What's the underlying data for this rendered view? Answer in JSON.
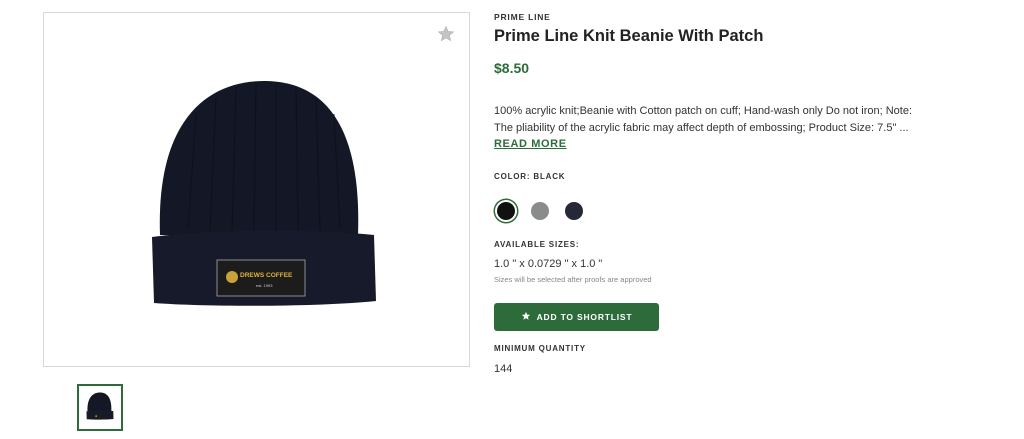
{
  "product": {
    "brand": "PRIME LINE",
    "title": "Prime Line Knit Beanie With Patch",
    "price": "$8.50",
    "description_line1": "100% acrylic knit;Beanie with Cotton patch on cuff; Hand-wash only Do not iron; Note:",
    "description_line2": "The pliability of the acrylic fabric may affect depth of embossing; Product Size: 7.5\" ...",
    "read_more": "READ MORE",
    "patch_text": "DREWS COFFEE",
    "patch_subtext": "est. 1993"
  },
  "color": {
    "label": "COLOR: BLACK",
    "swatches": [
      {
        "name": "Black",
        "hex": "#111111",
        "selected": true
      },
      {
        "name": "Gray",
        "hex": "#8a8c8b",
        "selected": false
      },
      {
        "name": "Navy",
        "hex": "#262838",
        "selected": false
      }
    ]
  },
  "sizes": {
    "label": "AVAILABLE SIZES:",
    "value": "1.0 \" x 0.0729 \" x 1.0 \"",
    "note": "Sizes will be selected after proofs are approved"
  },
  "actions": {
    "add_to_shortlist": "ADD TO SHORTLIST"
  },
  "min_quantity": {
    "label": "MINIMUM QUANTITY",
    "value": "144"
  },
  "icons": {
    "favorite": "star-icon",
    "shortlist": "star-icon"
  },
  "colors": {
    "accent": "#2e6b3a",
    "star_gray": "#c4c4c4"
  }
}
